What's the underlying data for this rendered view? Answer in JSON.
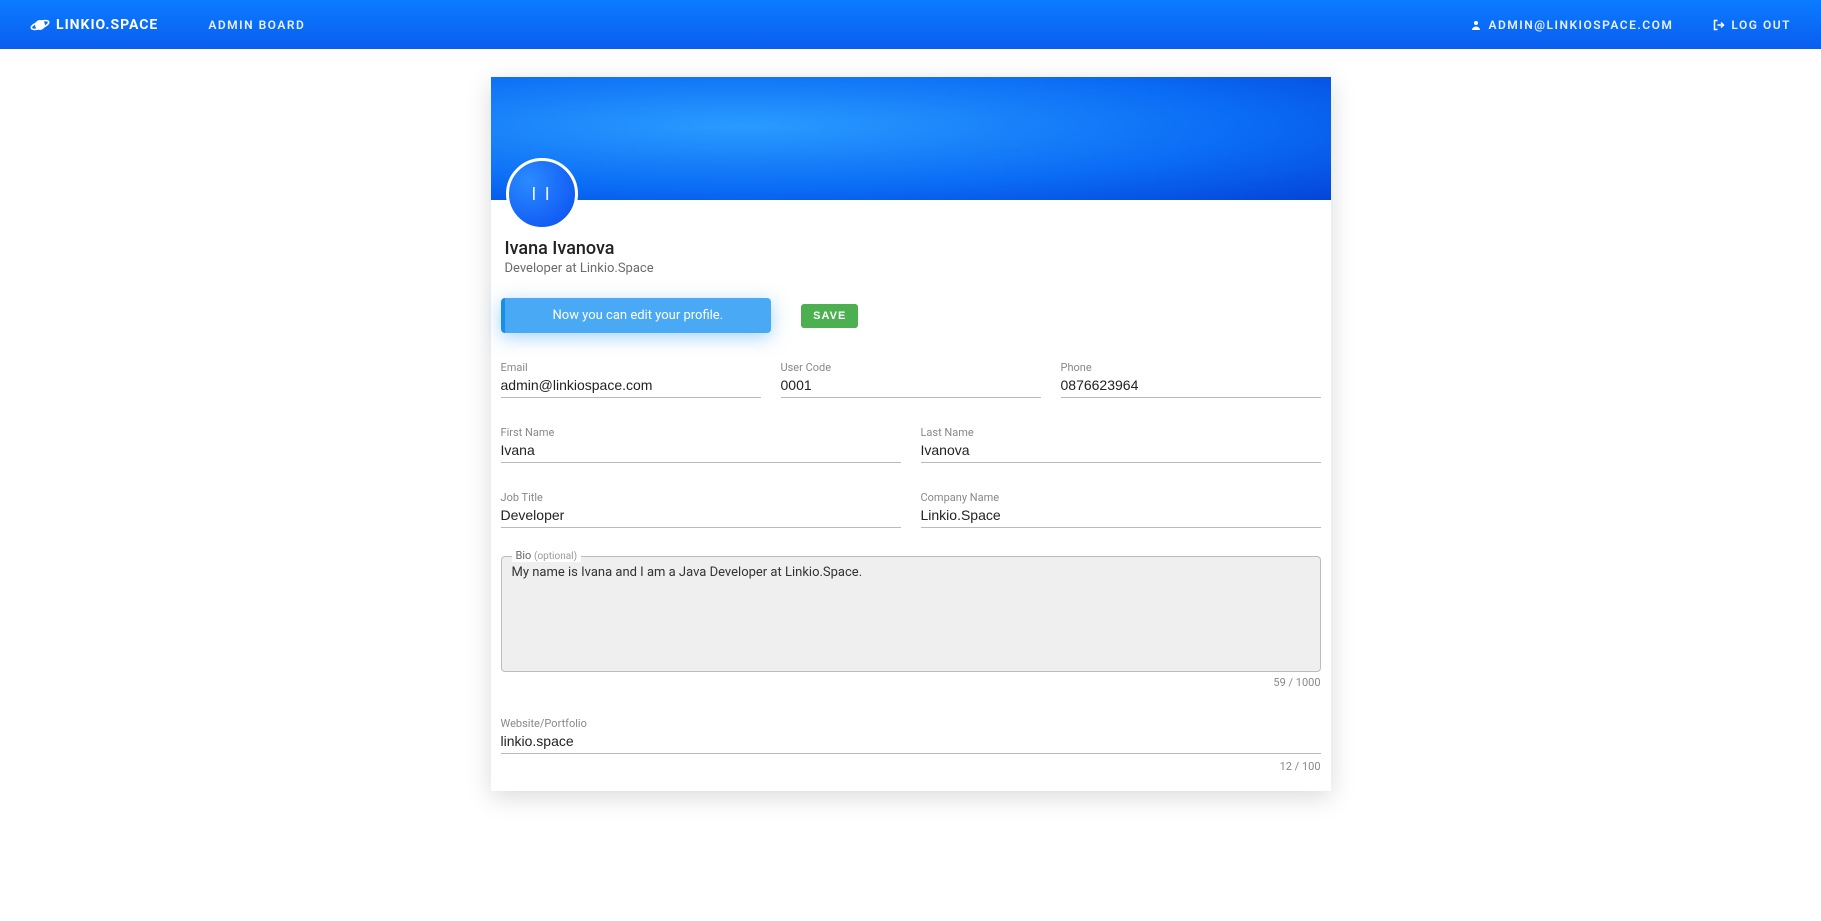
{
  "navbar": {
    "brand": "LINKIO.SPACE",
    "admin_board": "ADMIN BOARD",
    "user_email": "ADMIN@LINKIOSPACE.COM",
    "logout": "LOG OUT"
  },
  "profile": {
    "avatar_initials": "I I",
    "full_name": "Ivana Ivanova",
    "subtitle": "Developer at Linkio.Space"
  },
  "banner_message": "Now you can edit your profile.",
  "save_label": "SAVE",
  "fields": {
    "email": {
      "label": "Email",
      "value": "admin@linkiospace.com"
    },
    "user_code": {
      "label": "User Code",
      "value": "0001"
    },
    "phone": {
      "label": "Phone",
      "value": "0876623964"
    },
    "first_name": {
      "label": "First Name",
      "value": "Ivana"
    },
    "last_name": {
      "label": "Last Name",
      "value": "Ivanova"
    },
    "job_title": {
      "label": "Job Title",
      "value": "Developer"
    },
    "company_name": {
      "label": "Company Name",
      "value": "Linkio.Space"
    },
    "bio": {
      "label": "Bio",
      "optional": "(optional)",
      "value": "My name is Ivana and I am a Java Developer at Linkio.Space.",
      "counter": "59 / 1000"
    },
    "website": {
      "label": "Website/Portfolio",
      "value": "linkio.space",
      "counter": "12 / 100"
    }
  }
}
